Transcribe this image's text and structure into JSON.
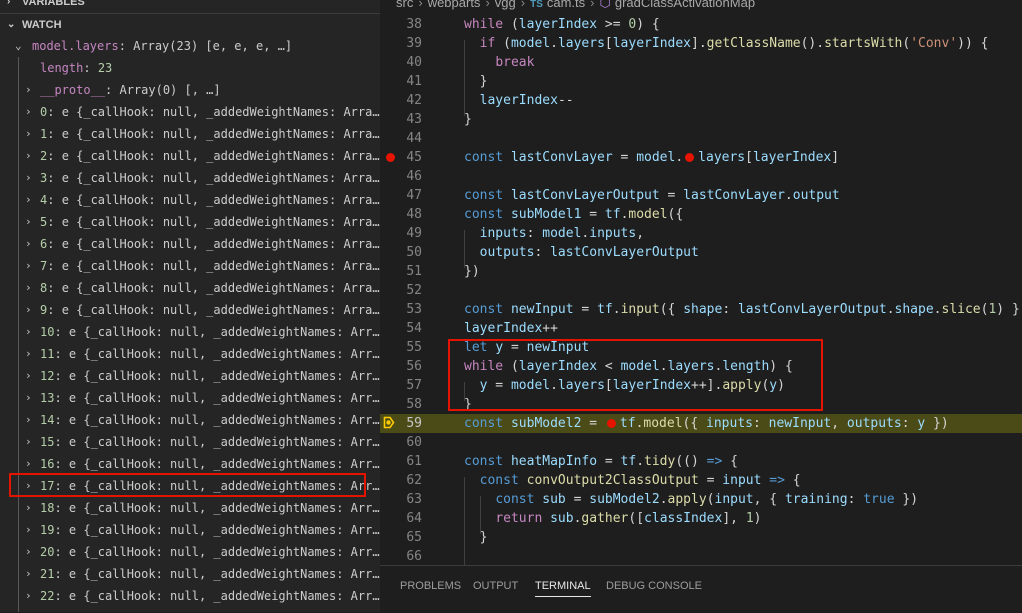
{
  "debug": {
    "variables_header": "VARIABLES",
    "watch_header": "WATCH",
    "root": {
      "name": "model.layers",
      "value": "Array(23) [e, e, e, …]"
    },
    "length": {
      "name": "length",
      "value": "23"
    },
    "proto": {
      "name": "__proto__",
      "value": "Array(0) [, …]"
    },
    "items": [
      {
        "index": "0",
        "text": "e {_callHook: null, _addedWeightNames: Arra…"
      },
      {
        "index": "1",
        "text": "e {_callHook: null, _addedWeightNames: Arra…"
      },
      {
        "index": "2",
        "text": "e {_callHook: null, _addedWeightNames: Arra…"
      },
      {
        "index": "3",
        "text": "e {_callHook: null, _addedWeightNames: Arra…"
      },
      {
        "index": "4",
        "text": "e {_callHook: null, _addedWeightNames: Arra…"
      },
      {
        "index": "5",
        "text": "e {_callHook: null, _addedWeightNames: Arra…"
      },
      {
        "index": "6",
        "text": "e {_callHook: null, _addedWeightNames: Arra…"
      },
      {
        "index": "7",
        "text": "e {_callHook: null, _addedWeightNames: Arra…"
      },
      {
        "index": "8",
        "text": "e {_callHook: null, _addedWeightNames: Arra…"
      },
      {
        "index": "9",
        "text": "e {_callHook: null, _addedWeightNames: Arra…"
      },
      {
        "index": "10",
        "text": "e {_callHook: null, _addedWeightNames: Arr…"
      },
      {
        "index": "11",
        "text": "e {_callHook: null, _addedWeightNames: Arr…"
      },
      {
        "index": "12",
        "text": "e {_callHook: null, _addedWeightNames: Arr…"
      },
      {
        "index": "13",
        "text": "e {_callHook: null, _addedWeightNames: Arr…"
      },
      {
        "index": "14",
        "text": "e {_callHook: null, _addedWeightNames: Arr…"
      },
      {
        "index": "15",
        "text": "e {_callHook: null, _addedWeightNames: Arr…"
      },
      {
        "index": "16",
        "text": "e {_callHook: null, _addedWeightNames: Arr…"
      },
      {
        "index": "17",
        "text": "e {_callHook: null, _addedWeightNames: Arr…"
      },
      {
        "index": "18",
        "text": "e {_callHook: null, _addedWeightNames: Arr…"
      },
      {
        "index": "19",
        "text": "e {_callHook: null, _addedWeightNames: Arr…"
      },
      {
        "index": "20",
        "text": "e {_callHook: null, _addedWeightNames: Arr…"
      },
      {
        "index": "21",
        "text": "e {_callHook: null, _addedWeightNames: Arr…"
      },
      {
        "index": "22",
        "text": "e {_callHook: null, _addedWeightNames: Arr…"
      }
    ]
  },
  "breadcrumbs": {
    "parts": [
      "src",
      "webparts",
      "vgg"
    ],
    "file_badge": "TS",
    "file": "cam.ts",
    "symbol": "gradClassActivationMap"
  },
  "code_lines": [
    {
      "num": "38",
      "tokens": [
        [
          "ck",
          "while"
        ],
        [
          "cp",
          " ("
        ],
        [
          "cv",
          "layerIndex"
        ],
        [
          "cp",
          " >= "
        ],
        [
          "cn",
          "0"
        ],
        [
          "cp",
          ") {"
        ]
      ]
    },
    {
      "num": "39",
      "tokens": [
        [
          "cp",
          "  "
        ],
        [
          "ck",
          "if"
        ],
        [
          "cp",
          " ("
        ],
        [
          "cv",
          "model"
        ],
        [
          "cp",
          "."
        ],
        [
          "cv",
          "layers"
        ],
        [
          "cp",
          "["
        ],
        [
          "cv",
          "layerIndex"
        ],
        [
          "cp",
          "]."
        ],
        [
          "cf",
          "getClassName"
        ],
        [
          "cp",
          "()."
        ],
        [
          "cf",
          "startsWith"
        ],
        [
          "cp",
          "("
        ],
        [
          "cs",
          "'Conv'"
        ],
        [
          "cp",
          "))"
        ],
        [
          "cp",
          " {"
        ]
      ]
    },
    {
      "num": "40",
      "tokens": [
        [
          "cp",
          "    "
        ],
        [
          "ck",
          "break"
        ]
      ]
    },
    {
      "num": "41",
      "tokens": [
        [
          "cp",
          "  }"
        ]
      ]
    },
    {
      "num": "42",
      "tokens": [
        [
          "cp",
          "  "
        ],
        [
          "cv",
          "layerIndex"
        ],
        [
          "cp",
          "--"
        ]
      ]
    },
    {
      "num": "43",
      "tokens": [
        [
          "cp",
          "}"
        ]
      ]
    },
    {
      "num": "44",
      "tokens": []
    },
    {
      "num": "45",
      "tokens": [
        [
          "cw",
          "const"
        ],
        [
          "cp",
          " "
        ],
        [
          "cv",
          "lastConvLayer"
        ],
        [
          "cp",
          " = "
        ],
        [
          "cv",
          "model"
        ],
        [
          "cp",
          "."
        ],
        [
          "bp",
          ""
        ],
        [
          "cv",
          "layers"
        ],
        [
          "cp",
          "["
        ],
        [
          "cv",
          "layerIndex"
        ],
        [
          "cp",
          "]"
        ]
      ]
    },
    {
      "num": "46",
      "tokens": []
    },
    {
      "num": "47",
      "tokens": [
        [
          "cw",
          "const"
        ],
        [
          "cp",
          " "
        ],
        [
          "cv",
          "lastConvLayerOutput"
        ],
        [
          "cp",
          " = "
        ],
        [
          "cv",
          "lastConvLayer"
        ],
        [
          "cp",
          "."
        ],
        [
          "cv",
          "output"
        ]
      ]
    },
    {
      "num": "48",
      "tokens": [
        [
          "cw",
          "const"
        ],
        [
          "cp",
          " "
        ],
        [
          "cv",
          "subModel1"
        ],
        [
          "cp",
          " = "
        ],
        [
          "cv",
          "tf"
        ],
        [
          "cp",
          "."
        ],
        [
          "cf",
          "model"
        ],
        [
          "cp",
          "({"
        ]
      ]
    },
    {
      "num": "49",
      "tokens": [
        [
          "cp",
          "  "
        ],
        [
          "cv",
          "inputs"
        ],
        [
          "cp",
          ": "
        ],
        [
          "cv",
          "model"
        ],
        [
          "cp",
          "."
        ],
        [
          "cv",
          "inputs"
        ],
        [
          "cp",
          ","
        ]
      ]
    },
    {
      "num": "50",
      "tokens": [
        [
          "cp",
          "  "
        ],
        [
          "cv",
          "outputs"
        ],
        [
          "cp",
          ": "
        ],
        [
          "cv",
          "lastConvLayerOutput"
        ]
      ]
    },
    {
      "num": "51",
      "tokens": [
        [
          "cp",
          "})"
        ]
      ]
    },
    {
      "num": "52",
      "tokens": []
    },
    {
      "num": "53",
      "tokens": [
        [
          "cw",
          "const"
        ],
        [
          "cp",
          " "
        ],
        [
          "cv",
          "newInput"
        ],
        [
          "cp",
          " = "
        ],
        [
          "cv",
          "tf"
        ],
        [
          "cp",
          "."
        ],
        [
          "cf",
          "input"
        ],
        [
          "cp",
          "({ "
        ],
        [
          "cv",
          "shape"
        ],
        [
          "cp",
          ": "
        ],
        [
          "cv",
          "lastConvLayerOutput"
        ],
        [
          "cp",
          "."
        ],
        [
          "cv",
          "shape"
        ],
        [
          "cp",
          "."
        ],
        [
          "cf",
          "slice"
        ],
        [
          "cp",
          "("
        ],
        [
          "cn",
          "1"
        ],
        [
          "cp",
          ") })"
        ]
      ]
    },
    {
      "num": "54",
      "tokens": [
        [
          "cv",
          "layerIndex"
        ],
        [
          "cp",
          "++"
        ]
      ]
    },
    {
      "num": "55",
      "tokens": [
        [
          "cw",
          "let"
        ],
        [
          "cp",
          " "
        ],
        [
          "cv",
          "y"
        ],
        [
          "cp",
          " = "
        ],
        [
          "cv",
          "newInput"
        ]
      ]
    },
    {
      "num": "56",
      "tokens": [
        [
          "ck",
          "while"
        ],
        [
          "cp",
          " ("
        ],
        [
          "cv",
          "layerIndex"
        ],
        [
          "cp",
          " < "
        ],
        [
          "cv",
          "model"
        ],
        [
          "cp",
          "."
        ],
        [
          "cv",
          "layers"
        ],
        [
          "cp",
          "."
        ],
        [
          "cv",
          "length"
        ],
        [
          "cp",
          ") {"
        ]
      ]
    },
    {
      "num": "57",
      "tokens": [
        [
          "cp",
          "  "
        ],
        [
          "cv",
          "y"
        ],
        [
          "cp",
          " = "
        ],
        [
          "cv",
          "model"
        ],
        [
          "cp",
          "."
        ],
        [
          "cv",
          "layers"
        ],
        [
          "cp",
          "["
        ],
        [
          "cv",
          "layerIndex"
        ],
        [
          "cp",
          "++]."
        ],
        [
          "cf",
          "apply"
        ],
        [
          "cp",
          "("
        ],
        [
          "cv",
          "y"
        ],
        [
          "cp",
          ")"
        ]
      ]
    },
    {
      "num": "58",
      "tokens": [
        [
          "cp",
          "}"
        ]
      ]
    },
    {
      "num": "59",
      "tokens": [
        [
          "cw",
          "const"
        ],
        [
          "cp",
          " "
        ],
        [
          "cv",
          "subModel2"
        ],
        [
          "cp",
          " = "
        ],
        [
          "bp",
          ""
        ],
        [
          "cv",
          "tf"
        ],
        [
          "cp",
          "."
        ],
        [
          "cf",
          "model"
        ],
        [
          "cp",
          "({ "
        ],
        [
          "cv",
          "inputs"
        ],
        [
          "cp",
          ": "
        ],
        [
          "cv",
          "newInput"
        ],
        [
          "cp",
          ", "
        ],
        [
          "cv",
          "outputs"
        ],
        [
          "cp",
          ": "
        ],
        [
          "cv",
          "y"
        ],
        [
          "cp",
          " })"
        ]
      ]
    },
    {
      "num": "60",
      "tokens": []
    },
    {
      "num": "61",
      "tokens": [
        [
          "cw",
          "const"
        ],
        [
          "cp",
          " "
        ],
        [
          "cv",
          "heatMapInfo"
        ],
        [
          "cp",
          " = "
        ],
        [
          "cv",
          "tf"
        ],
        [
          "cp",
          "."
        ],
        [
          "cf",
          "tidy"
        ],
        [
          "cp",
          "(() "
        ],
        [
          "cw",
          "=>"
        ],
        [
          "cp",
          " {"
        ]
      ]
    },
    {
      "num": "62",
      "tokens": [
        [
          "cp",
          "  "
        ],
        [
          "cw",
          "const"
        ],
        [
          "cp",
          " "
        ],
        [
          "cf",
          "convOutput2ClassOutput"
        ],
        [
          "cp",
          " = "
        ],
        [
          "cv",
          "input"
        ],
        [
          "cp",
          " "
        ],
        [
          "cw",
          "=>"
        ],
        [
          "cp",
          " {"
        ]
      ]
    },
    {
      "num": "63",
      "tokens": [
        [
          "cp",
          "    "
        ],
        [
          "cw",
          "const"
        ],
        [
          "cp",
          " "
        ],
        [
          "cv",
          "sub"
        ],
        [
          "cp",
          " = "
        ],
        [
          "cv",
          "subModel2"
        ],
        [
          "cp",
          "."
        ],
        [
          "cf",
          "apply"
        ],
        [
          "cp",
          "("
        ],
        [
          "cv",
          "input"
        ],
        [
          "cp",
          ", { "
        ],
        [
          "cv",
          "training"
        ],
        [
          "cp",
          ": "
        ],
        [
          "cw",
          "true"
        ],
        [
          "cp",
          " })"
        ]
      ]
    },
    {
      "num": "64",
      "tokens": [
        [
          "cp",
          "    "
        ],
        [
          "ck",
          "return"
        ],
        [
          "cp",
          " "
        ],
        [
          "cv",
          "sub"
        ],
        [
          "cp",
          "."
        ],
        [
          "cf",
          "gather"
        ],
        [
          "cp",
          "(["
        ],
        [
          "cv",
          "classIndex"
        ],
        [
          "cp",
          "], "
        ],
        [
          "cn",
          "1"
        ],
        [
          "cp",
          ")"
        ]
      ]
    },
    {
      "num": "65",
      "tokens": [
        [
          "cp",
          "  }"
        ]
      ]
    },
    {
      "num": "66",
      "tokens": []
    }
  ],
  "panel_tabs": [
    {
      "label": "PROBLEMS",
      "active": false
    },
    {
      "label": "OUTPUT",
      "active": false
    },
    {
      "label": "TERMINAL",
      "active": true
    },
    {
      "label": "DEBUG CONSOLE",
      "active": false
    }
  ],
  "colors": {
    "breakpoint": "#e51400",
    "current_line": "#4b4b18",
    "annotation_box": "#e51400"
  }
}
